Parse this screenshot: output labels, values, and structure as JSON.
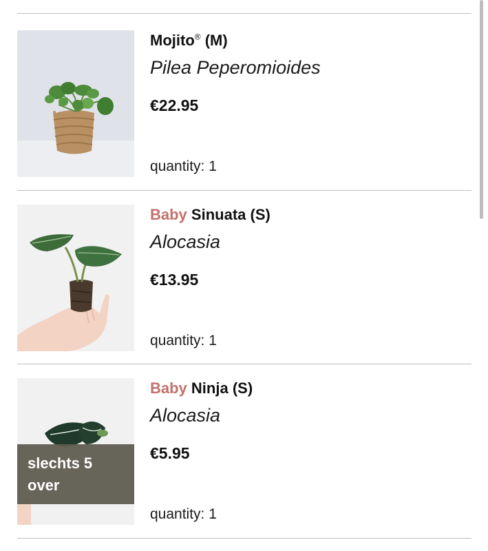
{
  "cart": {
    "items": [
      {
        "prefix": "",
        "name": "Mojito",
        "reg_mark": "®",
        "size": "(M)",
        "latin": "Pilea Peperomioides",
        "price": "€22.95",
        "quantity": "quantity: 1",
        "image_icon": "pilea-plant-image"
      },
      {
        "prefix": "Baby",
        "name": "Sinuata",
        "size": "(S)",
        "latin": "Alocasia",
        "price": "€13.95",
        "quantity": "quantity: 1",
        "image_icon": "alocasia-sinuata-image"
      },
      {
        "prefix": "Baby",
        "name": "Ninja",
        "size": "(S)",
        "latin": "Alocasia",
        "price": "€5.95",
        "quantity": "quantity: 1",
        "badge": "slechts 5 over",
        "image_icon": "alocasia-ninja-image"
      }
    ]
  },
  "colors": {
    "accent_baby": "#c2716b",
    "badge_bg": "#5f5c50",
    "divider": "#bdbdbd"
  }
}
